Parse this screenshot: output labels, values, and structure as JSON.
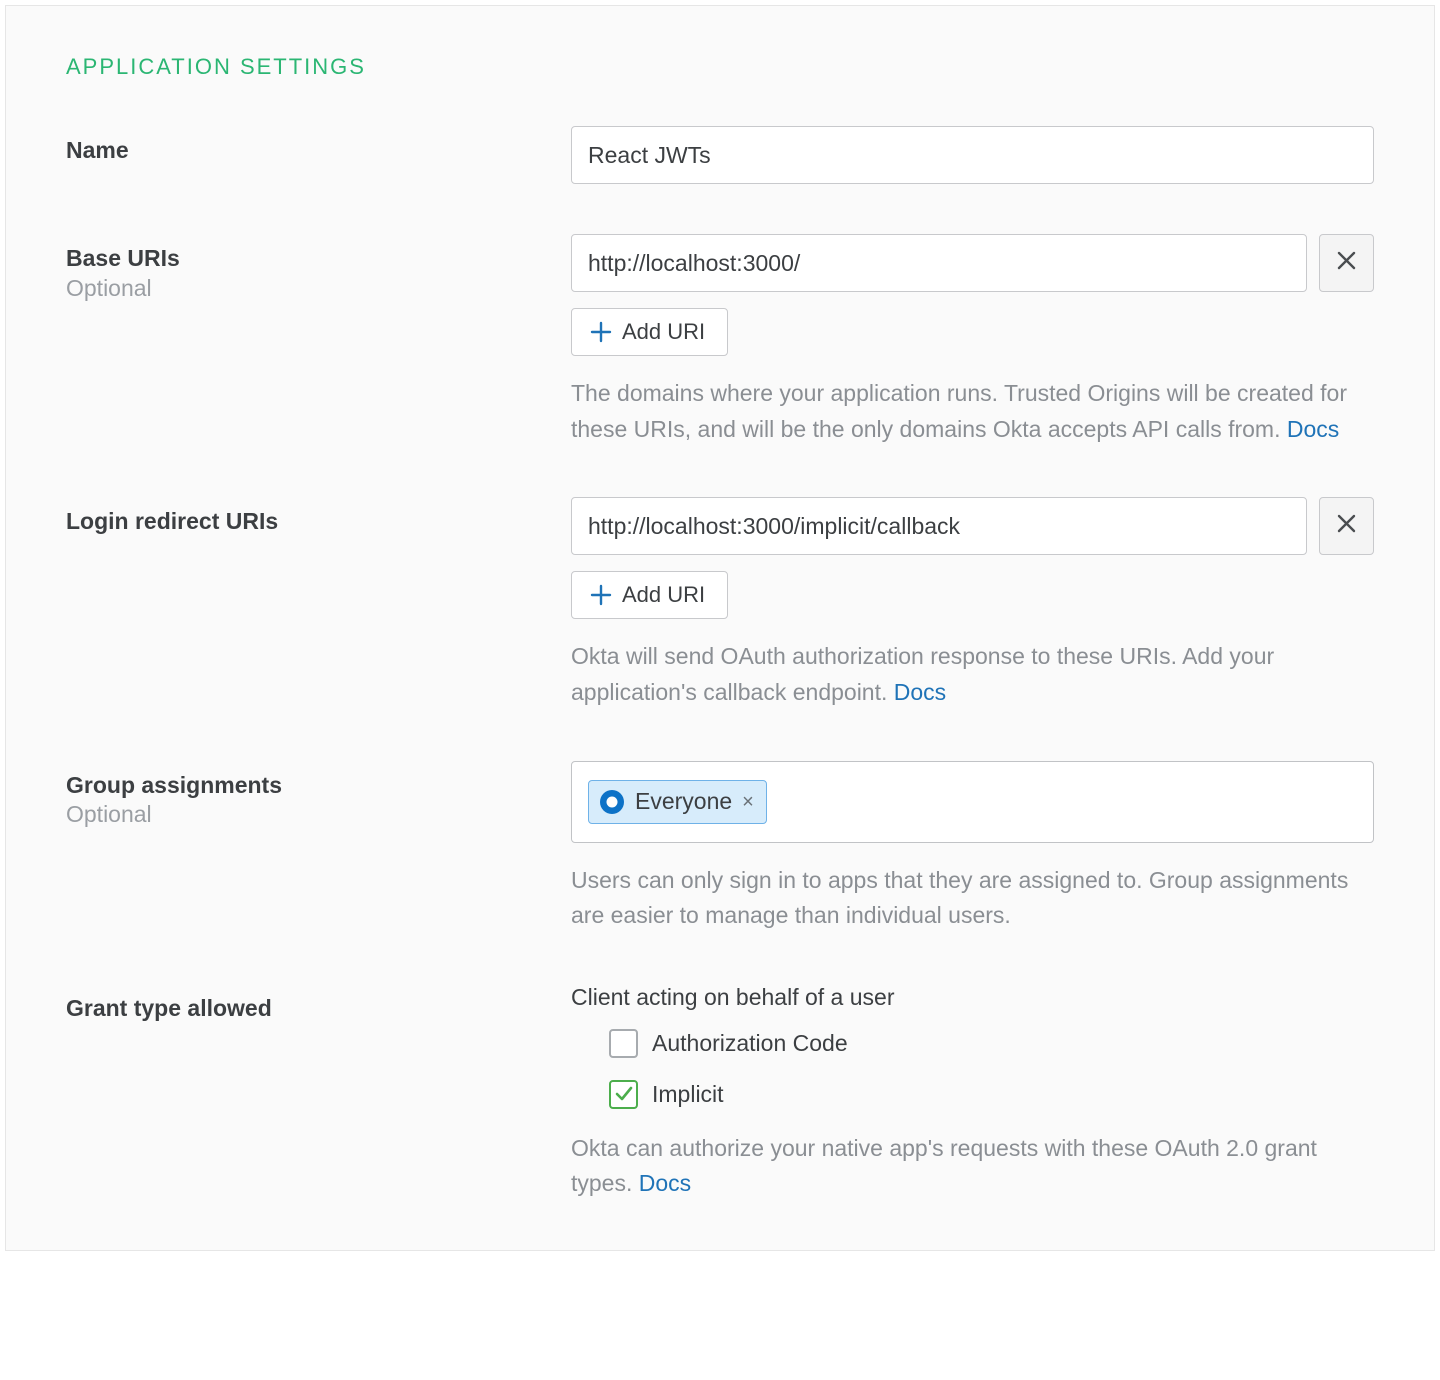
{
  "section_title": "APPLICATION SETTINGS",
  "optional_label": "Optional",
  "docs_label": "Docs",
  "add_uri_label": "Add URI",
  "fields": {
    "name": {
      "label": "Name",
      "value": "React JWTs"
    },
    "base_uris": {
      "label": "Base URIs",
      "value": "http://localhost:3000/",
      "help": "The domains where your application runs. Trusted Origins will be created for these URIs, and will be the only domains Okta accepts API calls from. "
    },
    "login_redirect_uris": {
      "label": "Login redirect URIs",
      "value": "http://localhost:3000/implicit/callback",
      "help": "Okta will send OAuth authorization response to these URIs. Add your application's callback endpoint. "
    },
    "group_assignments": {
      "label": "Group assignments",
      "chip": "Everyone",
      "help": "Users can only sign in to apps that they are assigned to. Group assignments are easier to manage than individual users."
    },
    "grant_type": {
      "label": "Grant type allowed",
      "sub_label": "Client acting on behalf of a user",
      "options": {
        "authorization_code": {
          "label": "Authorization Code",
          "checked": false
        },
        "implicit": {
          "label": "Implicit",
          "checked": true
        }
      },
      "help": "Okta can authorize your native app's requests with these OAuth 2.0 grant types. "
    }
  }
}
